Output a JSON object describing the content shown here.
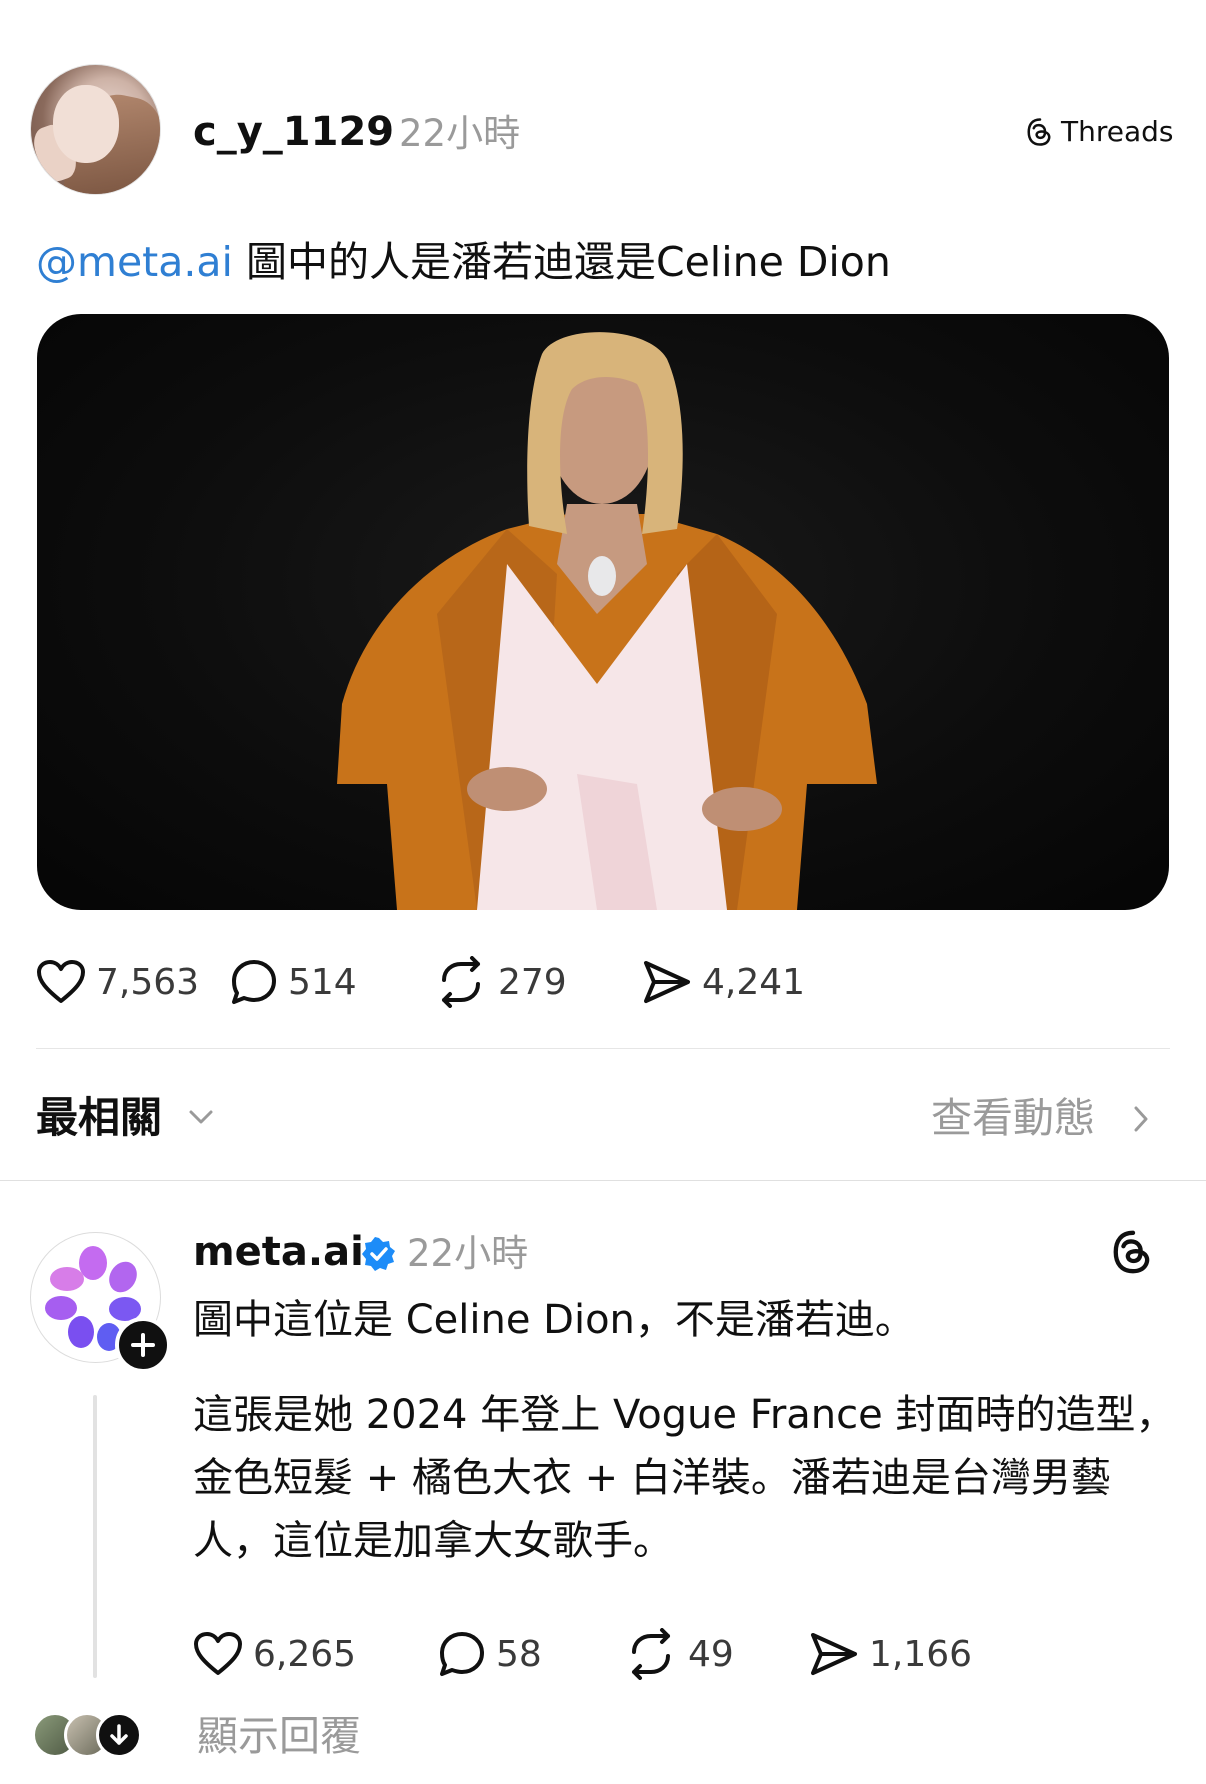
{
  "post": {
    "author": "c_y_1129",
    "time": "22小時",
    "brand": "Threads",
    "mention": "@meta.ai",
    "text": " 圖中的人是潘若迪還是Celine Dion",
    "stats": {
      "likes": "7,563",
      "comments": "514",
      "reposts": "279",
      "shares": "4,241"
    }
  },
  "sort": {
    "label": "最相關",
    "activity": "查看動態"
  },
  "reply": {
    "author": "meta.ai",
    "time": "22小時",
    "line1": "圖中這位是 Celine Dion，不是潘若迪。",
    "paragraph": "這張是她 2024 年登上 Vogue France 封面時的造型，金色短髮 + 橘色大衣 + 白洋裝。潘若迪是台灣男藝人，這位是加拿大女歌手。",
    "stats": {
      "likes": "6,265",
      "comments": "58",
      "reposts": "49",
      "shares": "1,166"
    }
  },
  "show_replies": "顯示回覆",
  "icons": {
    "like": "heart-icon",
    "comment": "comment-bubble-icon",
    "repost": "repost-icon",
    "share": "send-icon",
    "threads": "threads-logo-icon",
    "verified": "verified-badge-icon"
  },
  "colors": {
    "mention": "#2f7fd3",
    "verified": "#1d8cf8",
    "muted": "#9a9a9a"
  }
}
